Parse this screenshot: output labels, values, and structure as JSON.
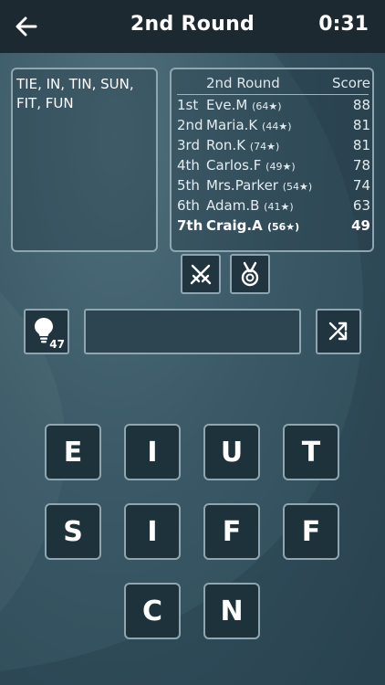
{
  "header": {
    "title": "2nd Round",
    "timer": "0:31"
  },
  "found_words": "TIE, IN, TIN, SUN, FIT, FUN",
  "leaderboard": {
    "title": "2nd Round",
    "score_label": "Score",
    "rows": [
      {
        "rank": "1st",
        "name": "Eve.M",
        "stars": "(64★)",
        "score": "88"
      },
      {
        "rank": "2nd",
        "name": "Maria.K",
        "stars": "(44★)",
        "score": "81"
      },
      {
        "rank": "3rd",
        "name": "Ron.K",
        "stars": "(74★)",
        "score": "81"
      },
      {
        "rank": "4th",
        "name": "Carlos.F",
        "stars": "(49★)",
        "score": "78"
      },
      {
        "rank": "5th",
        "name": "Mrs.Parker",
        "stars": "(54★)",
        "score": "74"
      },
      {
        "rank": "6th",
        "name": "Adam.B",
        "stars": "(41★)",
        "score": "63"
      },
      {
        "rank": "7th",
        "name": "Craig.A",
        "stars": "(56★)",
        "score": "49"
      }
    ]
  },
  "hint": {
    "count": "47"
  },
  "tiles": [
    "E",
    "I",
    "U",
    "T",
    "S",
    "I",
    "F",
    "F",
    "C",
    "N"
  ],
  "icons": {
    "back": "arrow-left-icon",
    "battle": "crossed-swords-icon",
    "medal": "medal-icon",
    "hint": "lightbulb-icon",
    "shuffle": "shuffle-icon"
  }
}
